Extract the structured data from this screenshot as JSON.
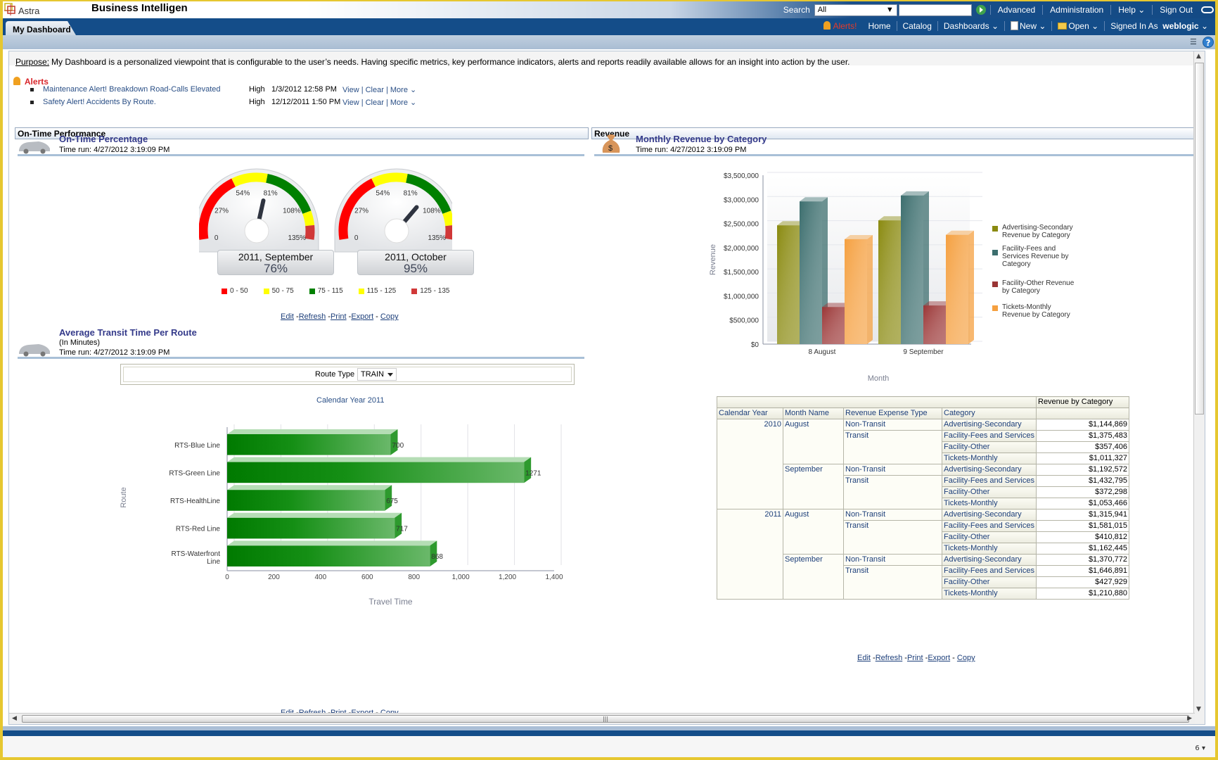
{
  "header": {
    "logo_text": "Astra",
    "app_title": "Business Intelligen",
    "search_label": "Search",
    "search_scope": "All",
    "search_value": "",
    "links": [
      "Advanced",
      "Administration",
      "Help",
      "Sign Out"
    ]
  },
  "nav": {
    "active_tab": "My Dashboard",
    "alerts_label": "Alerts!",
    "links": [
      "Home",
      "Catalog",
      "Dashboards",
      "New",
      "Open"
    ],
    "signed_in_label": "Signed In As",
    "user": "weblogic"
  },
  "purpose": {
    "label": "Purpose:",
    "text": "My Dashboard is a personalized viewpoint that is configurable to the user’s needs. Having specific metrics, key performance indicators, alerts and reports readily available allows for an insight into action by the user."
  },
  "alerts": {
    "title": "Alerts",
    "items": [
      {
        "message": "Maintenance Alert! Breakdown Road-Calls Elevated",
        "severity": "High",
        "date": "1/3/2012 12:58 PM",
        "actions": "View | Clear | More ⌄"
      },
      {
        "message": "Safety Alert! Accidents By Route.",
        "severity": "High",
        "date": "12/12/2011 1:50 PM",
        "actions": "View | Clear | More ⌄"
      }
    ]
  },
  "sections": {
    "left": "On-Time Performance",
    "right": "Revenue"
  },
  "report_links": {
    "edit": "Edit",
    "refresh": "Refresh",
    "print": "Print",
    "export": "Export",
    "copy": "Copy"
  },
  "ontime": {
    "title": "On-Time Percentage",
    "time_run": "Time run: 4/27/2012 3:19:09 PM"
  },
  "transit": {
    "title": "Average Transit Time Per Route",
    "subtitle": "(In Minutes)",
    "time_run": "Time run: 4/27/2012 3:19:09 PM",
    "prompt_label": "Route Type",
    "prompt_value": "TRAIN",
    "calendar_label": "Calendar Year  2011"
  },
  "revenue": {
    "title": "Monthly Revenue by Category",
    "time_run": "Time run: 4/27/2012 3:19:09 PM"
  },
  "pivot": {
    "measure_header": "Revenue by Category",
    "columns": [
      "Calendar Year",
      "Month Name",
      "Revenue Expense Type",
      "Category"
    ],
    "rows": [
      {
        "year": "2010",
        "month": "August",
        "type": "Non-Transit",
        "category": "Advertising-Secondary",
        "value": "$1,144,869"
      },
      {
        "year": "",
        "month": "",
        "type": "Transit",
        "category": "Facility-Fees and Services",
        "value": "$1,375,483"
      },
      {
        "year": "",
        "month": "",
        "type": "",
        "category": "Facility-Other",
        "value": "$357,406"
      },
      {
        "year": "",
        "month": "",
        "type": "",
        "category": "Tickets-Monthly",
        "value": "$1,011,327"
      },
      {
        "year": "",
        "month": "September",
        "type": "Non-Transit",
        "category": "Advertising-Secondary",
        "value": "$1,192,572"
      },
      {
        "year": "",
        "month": "",
        "type": "Transit",
        "category": "Facility-Fees and Services",
        "value": "$1,432,795"
      },
      {
        "year": "",
        "month": "",
        "type": "",
        "category": "Facility-Other",
        "value": "$372,298"
      },
      {
        "year": "",
        "month": "",
        "type": "",
        "category": "Tickets-Monthly",
        "value": "$1,053,466"
      },
      {
        "year": "2011",
        "month": "August",
        "type": "Non-Transit",
        "category": "Advertising-Secondary",
        "value": "$1,315,941"
      },
      {
        "year": "",
        "month": "",
        "type": "Transit",
        "category": "Facility-Fees and Services",
        "value": "$1,581,015"
      },
      {
        "year": "",
        "month": "",
        "type": "",
        "category": "Facility-Other",
        "value": "$410,812"
      },
      {
        "year": "",
        "month": "",
        "type": "",
        "category": "Tickets-Monthly",
        "value": "$1,162,445"
      },
      {
        "year": "",
        "month": "September",
        "type": "Non-Transit",
        "category": "Advertising-Secondary",
        "value": "$1,370,772"
      },
      {
        "year": "",
        "month": "",
        "type": "Transit",
        "category": "Facility-Fees and Services",
        "value": "$1,646,891"
      },
      {
        "year": "",
        "month": "",
        "type": "",
        "category": "Facility-Other",
        "value": "$427,929"
      },
      {
        "year": "",
        "month": "",
        "type": "",
        "category": "Tickets-Monthly",
        "value": "$1,210,880"
      }
    ]
  },
  "status": {
    "zoom_hint": "6"
  },
  "chart_data": [
    {
      "type": "gauge",
      "title": "On-Time Percentage",
      "scale_labels": [
        "0",
        "27%",
        "54%",
        "81%",
        "108%",
        "135%"
      ],
      "range": [
        0,
        135
      ],
      "bands": [
        {
          "label": "0 - 50",
          "from": 0,
          "to": 50,
          "color": "#ff0000"
        },
        {
          "label": "50 - 75",
          "from": 50,
          "to": 75,
          "color": "#ffff00"
        },
        {
          "label": "75 - 115",
          "from": 75,
          "to": 115,
          "color": "#008000"
        },
        {
          "label": "115 - 125",
          "from": 115,
          "to": 125,
          "color": "#ffff00"
        },
        {
          "label": "125 - 135",
          "from": 125,
          "to": 135,
          "color": "#d03838"
        }
      ],
      "gauges": [
        {
          "label": "2011, September",
          "value": 76,
          "display": "76%"
        },
        {
          "label": "2011, October",
          "value": 95,
          "display": "95%"
        }
      ]
    },
    {
      "type": "bar",
      "orientation": "horizontal",
      "title": "Average Transit Time Per Route",
      "categories": [
        "RTS-Blue Line",
        "RTS-Green Line",
        "RTS-HealthLine",
        "RTS-Red Line",
        "RTS-Waterfront Line"
      ],
      "values": [
        700,
        1271,
        675,
        717,
        868
      ],
      "xlabel": "Travel Time",
      "ylabel": "Route",
      "xlim": [
        0,
        1400
      ],
      "xticks": [
        "0",
        "200",
        "400",
        "600",
        "800",
        "1,000",
        "1,200",
        "1,400"
      ],
      "grid": true,
      "color": "#1a8a1a"
    },
    {
      "type": "bar",
      "title": "Monthly Revenue by Category",
      "categories": [
        "8 August",
        "9 September"
      ],
      "series": [
        {
          "name": "Advertising-Secondary Revenue by Category",
          "values": [
            2460810,
            2563344
          ],
          "color": "#8a8a10"
        },
        {
          "name": "Facility-Fees and Services Revenue by Category",
          "values": [
            2956498,
            3079686
          ],
          "color": "#3c6e6e"
        },
        {
          "name": "Facility-Other Revenue by Category",
          "values": [
            768218,
            800227
          ],
          "color": "#9a3535"
        },
        {
          "name": "Tickets-Monthly Revenue by Category",
          "values": [
            2173772,
            2264346
          ],
          "color": "#f5a040"
        }
      ],
      "xlabel": "Month",
      "ylabel": "Revenue",
      "ylim": [
        0,
        3500000
      ],
      "yticks": [
        "$0",
        "$500,000",
        "$1,000,000",
        "$1,500,000",
        "$2,000,000",
        "$2,500,000",
        "$3,000,000",
        "$3,500,000"
      ],
      "legend": "right",
      "grid": true
    }
  ]
}
